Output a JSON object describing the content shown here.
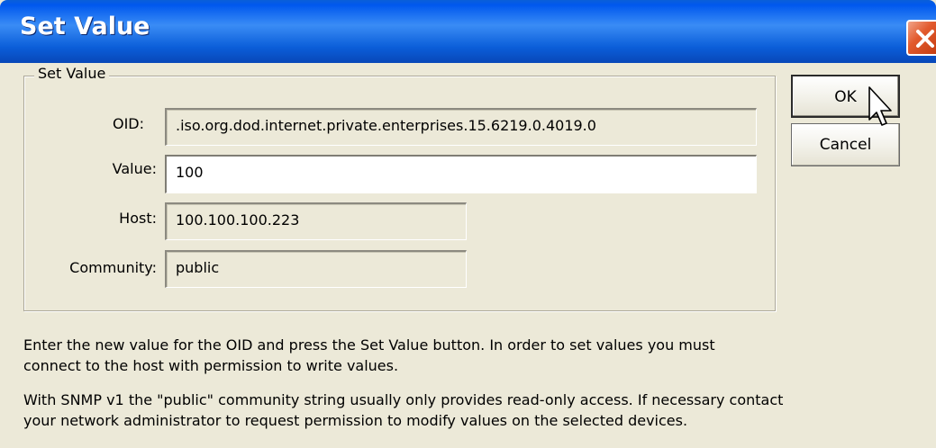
{
  "window": {
    "title": "Set Value"
  },
  "group": {
    "label": "Set Value"
  },
  "fields": {
    "oid": {
      "label": "OID:",
      "value": ".iso.org.dod.internet.private.enterprises.15.6219.0.4019.0"
    },
    "value": {
      "label": "Value:",
      "value": "100"
    },
    "host": {
      "label": "Host:",
      "value": "100.100.100.223"
    },
    "community": {
      "label": "Community:",
      "value": "public"
    }
  },
  "buttons": {
    "ok": "OK",
    "cancel": "Cancel"
  },
  "help": {
    "line1": "Enter the new value for the OID and press the Set Value button.  In order to set values you must",
    "line2": "connect to the host with permission to write values.",
    "line3": "With SNMP v1 the \"public\" community string usually only provides read-only access.  If necessary contact",
    "line4": "your network administrator to request permission to modify values on the selected devices."
  },
  "icons": {
    "close": "close-icon",
    "cursor": "mouse-pointer-icon"
  },
  "colors": {
    "titlebar": "#0058EE",
    "close_button": "#E25A2D",
    "dialog_background": "#ECE9D8"
  }
}
